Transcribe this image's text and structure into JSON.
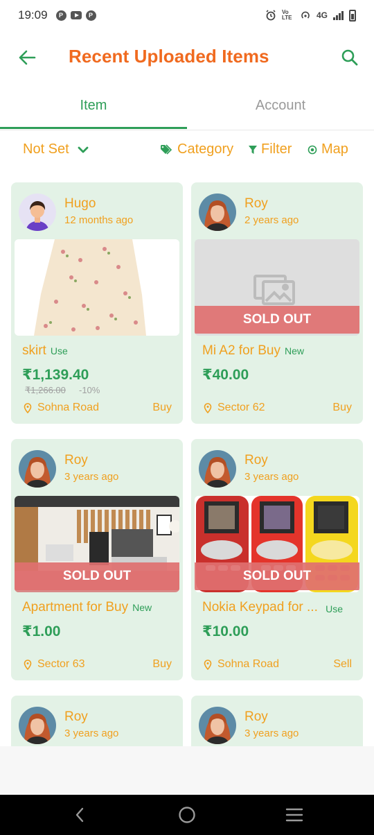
{
  "status_bar": {
    "time": "19:09",
    "network": "4G",
    "volte": "Vo LTE",
    "icons_left": [
      "app-icon",
      "youtube-icon",
      "app-icon"
    ],
    "icons_right": [
      "alarm-icon",
      "volte-icon",
      "hotspot-icon",
      "signal-icon",
      "battery-icon"
    ]
  },
  "header": {
    "title": "Recent Uploaded Items",
    "back_icon": "arrow-left-icon",
    "search_icon": "search-icon"
  },
  "tabs": [
    {
      "label": "Item",
      "active": true
    },
    {
      "label": "Account",
      "active": false
    }
  ],
  "filters": {
    "sort_value": "Not Set",
    "category_label": "Category",
    "filter_label": "Filter",
    "map_label": "Map"
  },
  "items": [
    {
      "user": "Hugo",
      "ago": "12 months ago",
      "title": "skirt",
      "condition": "Use",
      "price": "₹1,139.40",
      "old_price": "₹1,266.00",
      "discount": "-10%",
      "location": "Sohna Road",
      "type": "Buy",
      "sold_out": false
    },
    {
      "user": "Roy",
      "ago": "2 years ago",
      "title": "Mi A2 for Buy",
      "condition": "New",
      "price": "₹40.00",
      "location": "Sector 62",
      "type": "Buy",
      "sold_out": true,
      "sold_label": "SOLD OUT"
    },
    {
      "user": "Roy",
      "ago": "3 years ago",
      "title": "Apartment for Buy",
      "condition": "New",
      "price": "₹1.00",
      "location": "Sector 63",
      "type": "Buy",
      "sold_out": true,
      "sold_label": "SOLD OUT"
    },
    {
      "user": "Roy",
      "ago": "3 years ago",
      "title": "Nokia Keypad for ...",
      "condition": "Use",
      "price": "₹10.00",
      "location": "Sohna Road",
      "type": "Sell",
      "sold_out": true,
      "sold_label": "SOLD OUT"
    },
    {
      "user": "Roy",
      "ago": "3 years ago"
    },
    {
      "user": "Roy",
      "ago": "3 years ago"
    }
  ],
  "colors": {
    "primary_green": "#2e9e58",
    "title_orange": "#f06a1f",
    "accent_orange": "#f0a01f",
    "card_bg": "#e3f2e6",
    "sold_out_red": "#e07070"
  }
}
